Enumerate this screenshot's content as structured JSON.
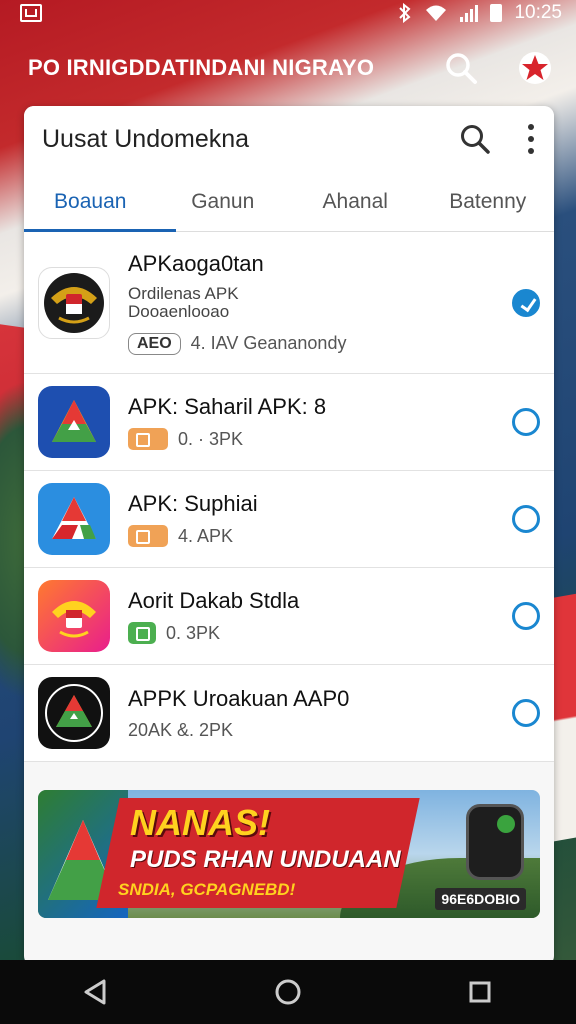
{
  "status_bar": {
    "time": "10:25",
    "icons": [
      "gallery-icon",
      "bluetooth-icon",
      "wifi-icon",
      "signal-icon",
      "battery-icon"
    ]
  },
  "app_header": {
    "title": "PO IRNIGDDATINDANI NIGRAYO",
    "icons": [
      "search-icon",
      "star-badge-icon"
    ]
  },
  "search_bar": {
    "text": "Uusat Undomekna"
  },
  "tabs": [
    {
      "label": "Boauan",
      "active": true
    },
    {
      "label": "Ganun",
      "active": false
    },
    {
      "label": "Ahanal",
      "active": false
    },
    {
      "label": "Batenny",
      "active": false
    }
  ],
  "items": [
    {
      "title": "APKaoga0tan",
      "sub_a": "Ordilenas APK",
      "sub_b": "Dooaenlooao",
      "chip": "AEO",
      "meta": "4. IAV Geananondy",
      "selected": true,
      "icon": "garuda-emblem-icon"
    },
    {
      "title": "APK: Saharil APK: 8",
      "meta": "0. · 3PK",
      "selected": false,
      "icon": "apk-triangle-blue-icon"
    },
    {
      "title": "APK: Suphiai",
      "meta": "4.   APK",
      "selected": false,
      "icon": "apk-triangle-light-icon"
    },
    {
      "title": "Aorit Dakab Stdla",
      "meta": "0.   3PK",
      "selected": false,
      "icon": "garuda-pink-icon"
    },
    {
      "title": "APPK Uroakuan AAP0",
      "meta": "20AK  &.  2PK",
      "selected": false,
      "icon": "apk-dark-badge-icon"
    }
  ],
  "banner": {
    "headline": "NANAS!",
    "subline": "PUDS RHAN UNDUAAN",
    "tagline": "SNDIA, GCPAGNEBD!",
    "badge": "96E6DOBIO"
  },
  "nav_bar": {
    "icons": [
      "back-icon",
      "home-icon",
      "recents-icon"
    ]
  },
  "colors": {
    "accent": "#1a63b3",
    "radio": "#1a87d0",
    "banner_red": "#d0262c",
    "banner_yellow": "#ffd21f"
  }
}
